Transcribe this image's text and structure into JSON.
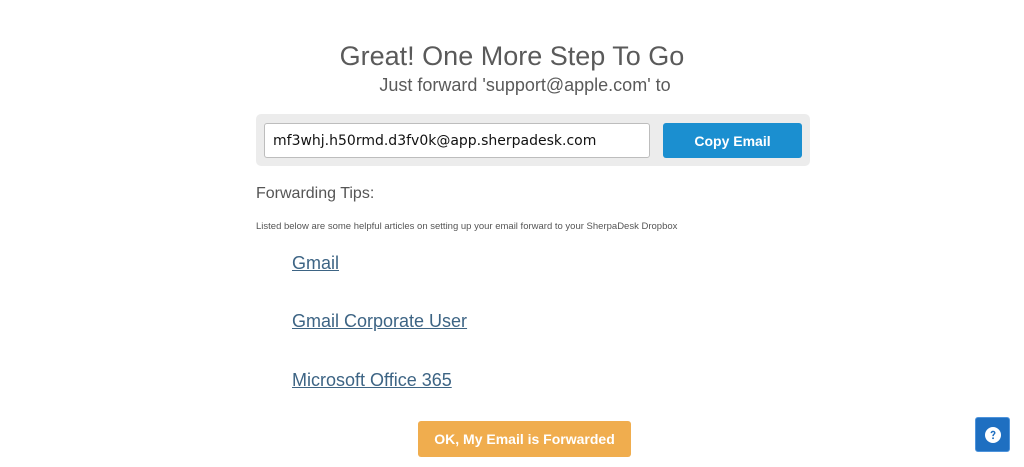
{
  "header": {
    "title": "Great! One More Step To Go",
    "subtitle": "Just forward 'support@apple.com' to"
  },
  "copy_panel": {
    "email_value": "mf3whj.h50rmd.d3fv0k@app.sherpadesk.com",
    "copy_button_label": "Copy Email"
  },
  "tips": {
    "heading": "Forwarding Tips:",
    "description": "Listed below are some helpful articles on setting up your email forward to your SherpaDesk Dropbox",
    "links": [
      {
        "label": "Gmail"
      },
      {
        "label": "Gmail Corporate User"
      },
      {
        "label": "Microsoft Office 365"
      }
    ]
  },
  "footer": {
    "confirm_button_label": "OK, My Email is Forwarded"
  },
  "help": {
    "icon": "question-circle-icon"
  },
  "colors": {
    "copy_button": "#1b8fd0",
    "confirm_button": "#f0ad4e",
    "link": "#3d6484",
    "help_button": "#1e6fc1",
    "panel_background": "#ececec"
  }
}
